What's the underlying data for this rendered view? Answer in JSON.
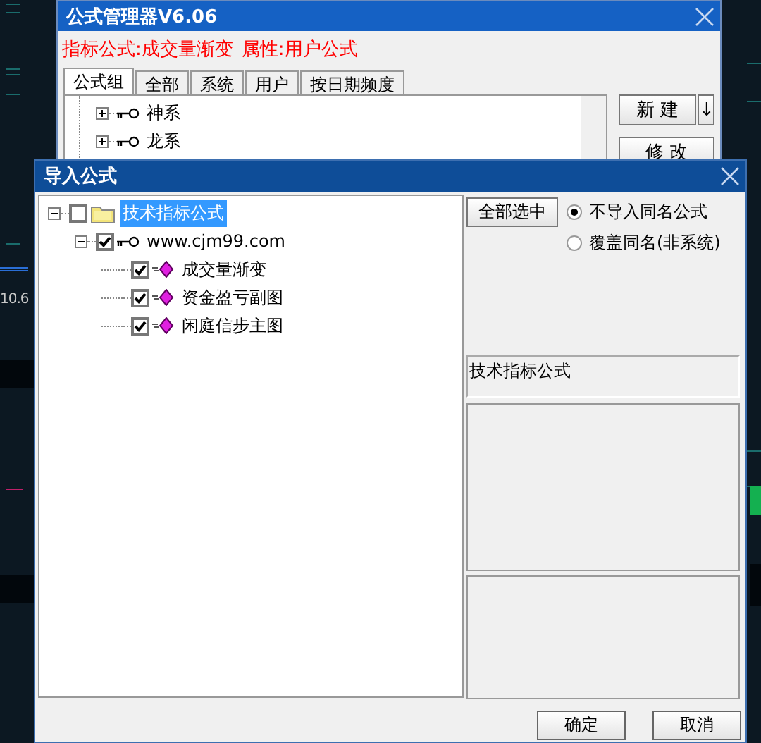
{
  "background": {
    "price_label": "10.6"
  },
  "manager": {
    "title": "公式管理器V6.06",
    "formula_label": "指标公式:成交量渐变",
    "attribute_label": "属性:用户公式",
    "tabs": [
      {
        "label": "公式组",
        "selected": true
      },
      {
        "label": "全部",
        "selected": false
      },
      {
        "label": "系统",
        "selected": false
      },
      {
        "label": "用户",
        "selected": false
      },
      {
        "label": "按日期频度",
        "selected": false
      }
    ],
    "tree": [
      {
        "label": "神系",
        "expanded": false
      },
      {
        "label": "龙系",
        "expanded": false
      }
    ],
    "buttons": [
      {
        "label": "新 建",
        "kind": "new"
      },
      {
        "label": "↓",
        "kind": "arrow"
      },
      {
        "label": "修 改",
        "kind": "edit"
      }
    ]
  },
  "dialog": {
    "title": "导入公式",
    "tree": [
      {
        "label": "技术指标公式",
        "kind": "folder",
        "checked": false,
        "expanded": true,
        "selected": true,
        "children": [
          {
            "label": "www.cjm99.com",
            "kind": "group",
            "checked": true,
            "expanded": true,
            "selected": false,
            "children": [
              {
                "label": "成交量渐变",
                "kind": "formula",
                "checked": true,
                "selected": false
              },
              {
                "label": "资金盈亏副图",
                "kind": "formula",
                "checked": true,
                "selected": false
              },
              {
                "label": "闲庭信步主图",
                "kind": "formula",
                "checked": true,
                "selected": false
              }
            ]
          }
        ]
      }
    ],
    "select_all": "全部选中",
    "options": [
      {
        "label": "不导入同名公式",
        "selected": true
      },
      {
        "label": "覆盖同名(非系统)",
        "selected": false
      }
    ],
    "info": "技术指标公式",
    "buttons": [
      "确定",
      "取消"
    ]
  }
}
